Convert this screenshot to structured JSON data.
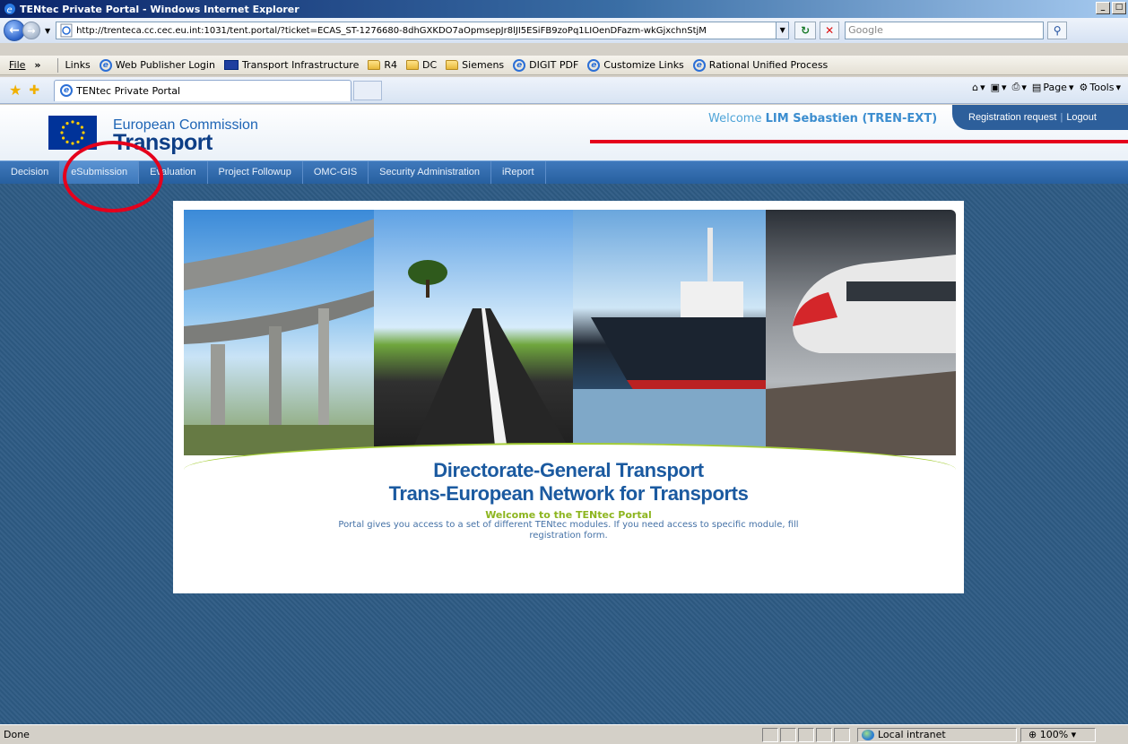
{
  "window": {
    "title": "TENtec Private Portal - Windows Internet Explorer"
  },
  "address_bar": {
    "url": "http://trenteca.cc.cec.eu.int:1031/tent.portal/?ticket=ECAS_ST-1276680-8dhGXKDO7aOpmsepJr8lJI5ESiFB9zoPq1LIOenDFazm-wkGjxchnStjM",
    "search_placeholder": "Google"
  },
  "links_bar": {
    "file_menu": "File",
    "chevron": "»",
    "label": "Links",
    "items": [
      {
        "label": "Web Publisher Login",
        "icon": "ie-page-icon"
      },
      {
        "label": "Transport Infrastructure",
        "icon": "eu-flag-icon"
      },
      {
        "label": "R4",
        "icon": "folder-icon"
      },
      {
        "label": "DC",
        "icon": "folder-icon"
      },
      {
        "label": "Siemens",
        "icon": "folder-icon"
      },
      {
        "label": "DIGIT PDF",
        "icon": "ie-page-icon"
      },
      {
        "label": "Customize Links",
        "icon": "ie-page-icon"
      },
      {
        "label": "Rational Unified Process",
        "icon": "ie-page-icon"
      }
    ]
  },
  "tabs": {
    "active_tab": "TENtec Private Portal"
  },
  "command_bar": {
    "page_label": "Page",
    "tools_label": "Tools"
  },
  "portal": {
    "org_name": "European Commission",
    "org_dept": "Transport",
    "welcome_prefix": "Welcome",
    "user_name": "LIM Sebastien (TREN-EXT)",
    "registration_link": "Registration request",
    "separator": "|",
    "logout_link": "Logout",
    "menu": [
      "Decision",
      "eSubmission",
      "Evaluation",
      "Project Followup",
      "OMC-GIS",
      "Security Administration",
      "iReport"
    ],
    "heading_line1": "Directorate-General Transport",
    "heading_line2": "Trans-European Network for Transports",
    "welcome_portal": "Welcome to the TENtec Portal",
    "description": "Portal gives you access to a set of different TENtec modules. If you need access to specific module, fill registration form."
  },
  "status_bar": {
    "status": "Done",
    "zone": "Local intranet",
    "zoom": "100%"
  },
  "colors": {
    "annotation": "#e5001c",
    "menubar": "#2f69ad",
    "page_bg": "#2e5b84",
    "heading": "#1b5aa0",
    "accent_green": "#8db51f"
  }
}
